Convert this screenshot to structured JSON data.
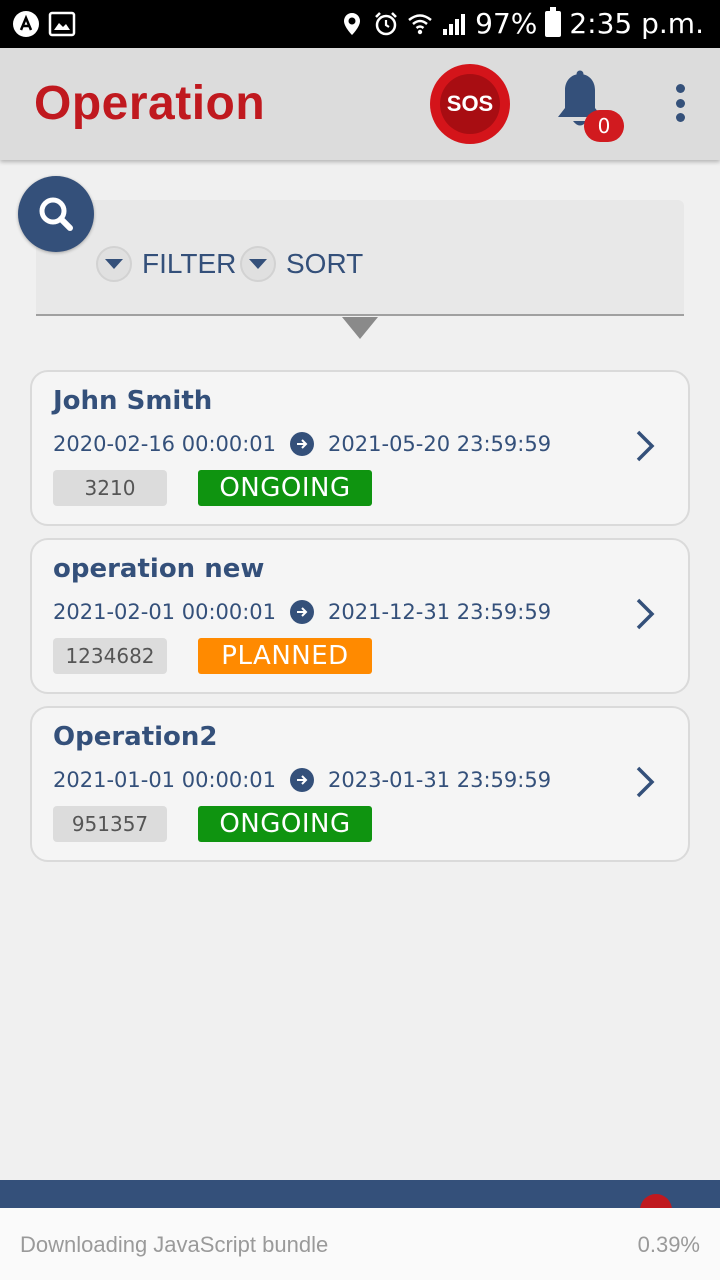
{
  "status_bar": {
    "battery": "97%",
    "time": "2:35 p.m.",
    "icons": [
      "app-a-icon",
      "image-icon",
      "location-icon",
      "alarm-icon",
      "wifi-icon",
      "signal-icon",
      "battery-icon"
    ]
  },
  "header": {
    "title": "Operation",
    "sos_label": "SOS",
    "notification_count": "0"
  },
  "filters": {
    "filter_label": "FILTER",
    "sort_label": "SORT"
  },
  "operations": [
    {
      "name": "John Smith",
      "start": "2020-02-16 00:00:01",
      "end": "2021-05-20 23:59:59",
      "id": "3210",
      "status": "ONGOING",
      "status_color": "#0f9410"
    },
    {
      "name": "operation new",
      "start": "2021-02-01 00:00:01",
      "end": "2021-12-31 23:59:59",
      "id": "1234682",
      "status": "PLANNED",
      "status_color": "#ff8a00"
    },
    {
      "name": "Operation2",
      "start": "2021-01-01 00:00:01",
      "end": "2023-01-31 23:59:59",
      "id": "951357",
      "status": "ONGOING",
      "status_color": "#0f9410"
    }
  ],
  "download": {
    "text": "Downloading JavaScript bundle",
    "percent": "0.39%"
  },
  "colors": {
    "brand_red": "#c0191f",
    "primary_blue": "#34507a"
  }
}
